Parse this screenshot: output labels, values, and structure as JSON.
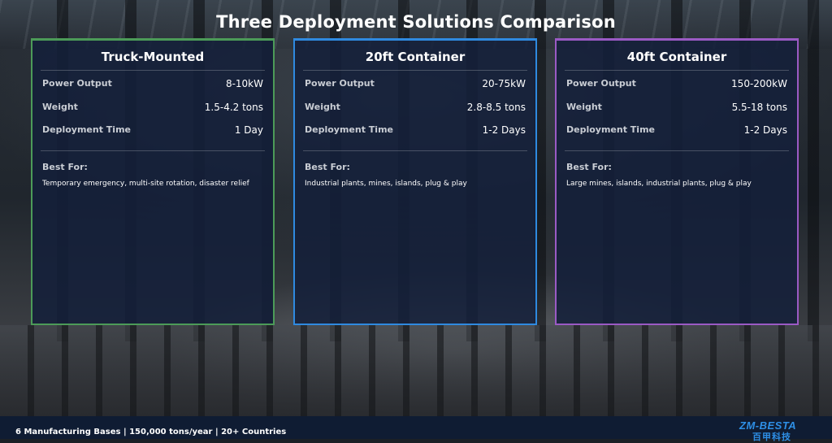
{
  "title": "Three Deployment Solutions Comparison",
  "cards": [
    {
      "name": "Truck-Mounted",
      "specs": [
        {
          "label": "Power Output",
          "value": "8-10kW"
        },
        {
          "label": "Weight",
          "value": "1.5-4.2 tons"
        },
        {
          "label": "Deployment Time",
          "value": "1 Day"
        }
      ],
      "best_for_label": "Best For:",
      "best_for": "Temporary emergency, multi-site rotation, disaster relief",
      "accent": "#4c9b58"
    },
    {
      "name": "20ft Container",
      "specs": [
        {
          "label": "Power Output",
          "value": "20-75kW"
        },
        {
          "label": "Weight",
          "value": "2.8-8.5 tons"
        },
        {
          "label": "Deployment Time",
          "value": "1-2 Days"
        }
      ],
      "best_for_label": "Best For:",
      "best_for": "Industrial plants, mines, islands, plug & play",
      "accent": "#2f8ae0"
    },
    {
      "name": "40ft Container",
      "specs": [
        {
          "label": "Power Output",
          "value": "150-200kW"
        },
        {
          "label": "Weight",
          "value": "5.5-18 tons"
        },
        {
          "label": "Deployment Time",
          "value": "1-2 Days"
        }
      ],
      "best_for_label": "Best For:",
      "best_for": "Large mines, islands, industrial plants, plug & play",
      "accent": "#9b5ac4"
    }
  ],
  "footer": {
    "text": "6 Manufacturing Bases | 150,000 tons/year | 20+ Countries",
    "logo_main": "ZM-BESTA",
    "logo_sub": "百甲科技"
  },
  "colors": {
    "footer_bg": "#0f1c33",
    "logo": "#2e8fe6"
  }
}
